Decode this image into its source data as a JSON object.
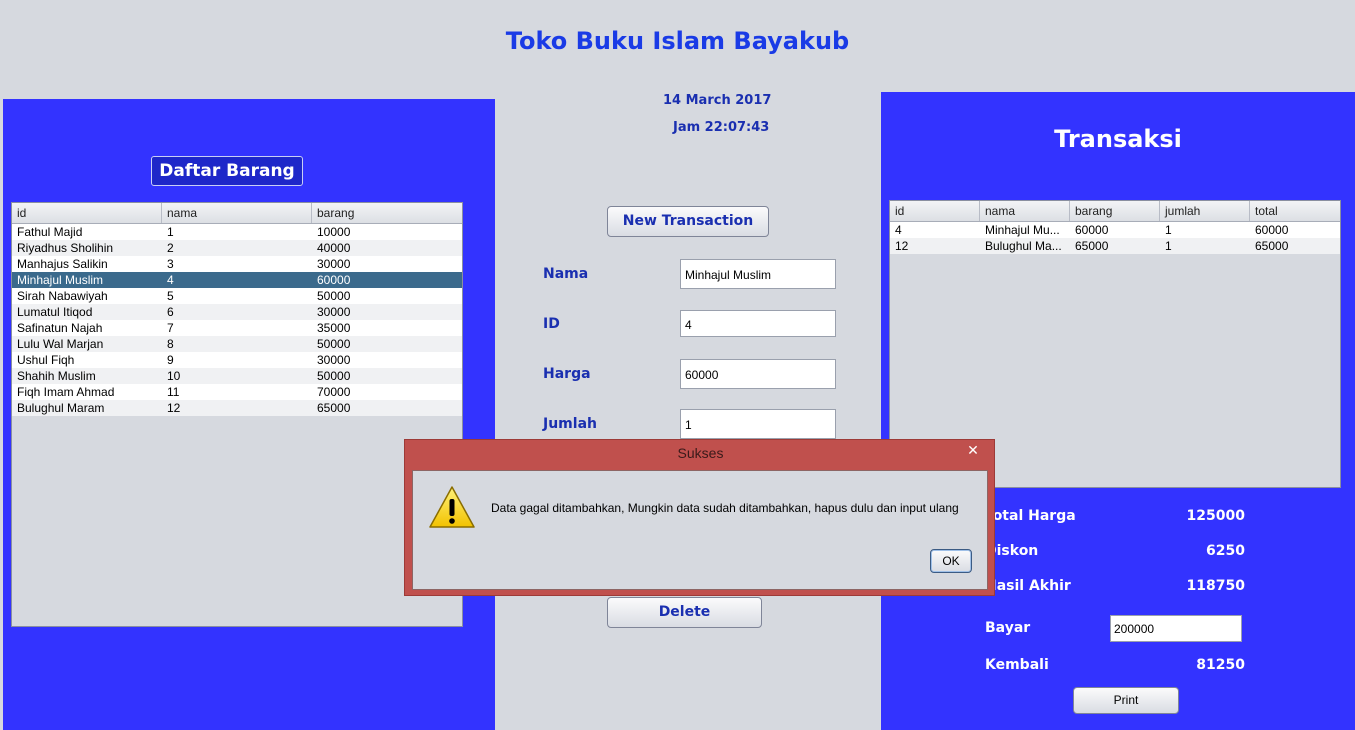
{
  "app": {
    "title": "Toko Buku Islam Bayakub",
    "date": "14 March 2017",
    "time": "Jam 22:07:43"
  },
  "colors": {
    "panel_blue": "#3333ff",
    "title_blue": "#1a3be6",
    "selected_row": "#3b6a8c",
    "dialog_red": "#c0504d"
  },
  "daftar_barang": {
    "heading": "Daftar Barang",
    "columns": [
      "id",
      "nama",
      "barang"
    ],
    "selected_index": 3,
    "rows": [
      [
        "Fathul Majid",
        "1",
        "10000"
      ],
      [
        "Riyadhus Sholihin",
        "2",
        "40000"
      ],
      [
        "Manhajus Salikin",
        "3",
        "30000"
      ],
      [
        "Minhajul Muslim",
        "4",
        "60000"
      ],
      [
        "Sirah Nabawiyah",
        "5",
        "50000"
      ],
      [
        "Lumatul Itiqod",
        "6",
        "30000"
      ],
      [
        "Safinatun Najah",
        "7",
        "35000"
      ],
      [
        "Lulu Wal Marjan",
        "8",
        "50000"
      ],
      [
        "Ushul Fiqh",
        "9",
        "30000"
      ],
      [
        "Shahih Muslim",
        "10",
        "50000"
      ],
      [
        "Fiqh Imam Ahmad",
        "11",
        "70000"
      ],
      [
        "Bulughul Maram",
        "12",
        "65000"
      ]
    ]
  },
  "form": {
    "new_transaction_label": "New Transaction",
    "nama_label": "Nama",
    "nama_value": "Minhajul Muslim",
    "id_label": "ID",
    "id_value": "4",
    "harga_label": "Harga",
    "harga_value": "60000",
    "jumlah_label": "Jumlah",
    "jumlah_value": "1",
    "delete_label": "Delete"
  },
  "transaksi": {
    "heading": "Transaksi",
    "columns": [
      "id",
      "nama",
      "barang",
      "jumlah",
      "total"
    ],
    "rows": [
      [
        "4",
        "Minhajul Mu...",
        "60000",
        "1",
        "60000"
      ],
      [
        "12",
        "Bulughul Ma...",
        "65000",
        "1",
        "65000"
      ]
    ],
    "total_harga_label": "Total Harga",
    "total_harga": "125000",
    "diskon_label": "Diskon",
    "diskon": "6250",
    "hasil_akhir_label": "Hasil Akhir",
    "hasil_akhir": "118750",
    "bayar_label": "Bayar",
    "bayar_value": "200000",
    "kembali_label": "Kembali",
    "kembali": "81250",
    "print_label": "Print"
  },
  "dialog": {
    "title": "Sukses",
    "close_glyph": "✕",
    "icon": "warning-icon",
    "message": "Data gagal ditambahkan, Mungkin data sudah ditambahkan, hapus dulu dan input ulang",
    "ok_label": "OK"
  }
}
